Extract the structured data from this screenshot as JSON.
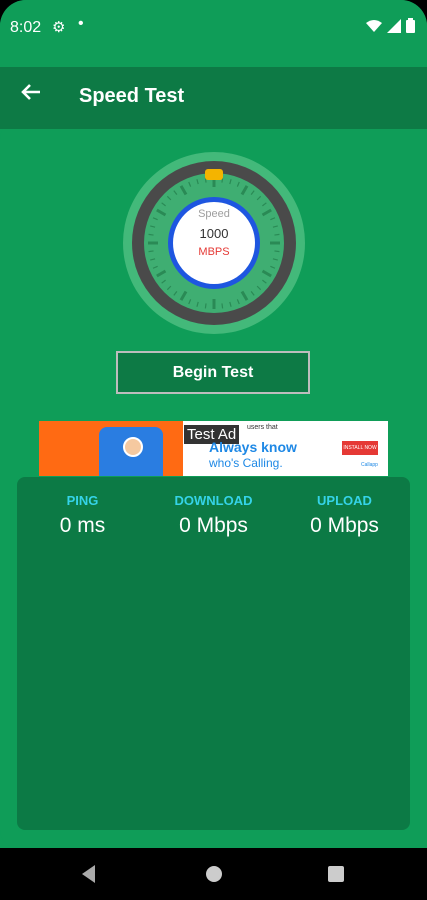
{
  "status_bar": {
    "time": "8:02",
    "gear_icon": "gear-icon",
    "dot": "•"
  },
  "app_bar": {
    "back_icon": "arrow-left-icon",
    "title": "Speed Test"
  },
  "gauge": {
    "speed_label": "Speed",
    "value": "1000",
    "unit": "MBPS"
  },
  "begin_button": "Begin Test",
  "ad": {
    "label": "Test Ad",
    "line1": "users that",
    "line2": "Always know",
    "line3": "who's Calling.",
    "install": "INSTALL NOW",
    "logo": "Callapp"
  },
  "stats": [
    {
      "label": "PING",
      "value": "0 ms"
    },
    {
      "label": "DOWNLOAD",
      "value": "0 Mbps"
    },
    {
      "label": "UPLOAD",
      "value": "0 Mbps"
    }
  ],
  "colors": {
    "primary": "#0f9d58",
    "dark": "#0d7a45",
    "accent": "#35d3e8",
    "gauge_ring": "#4a4a4a",
    "gauge_blue": "#1e56e0",
    "unit_red": "#e53935"
  }
}
